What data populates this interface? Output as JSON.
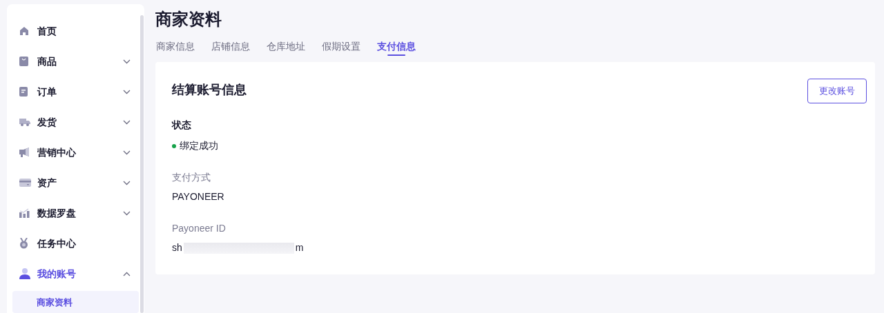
{
  "sidebar": {
    "items": [
      {
        "label": "首页",
        "selected": false
      },
      {
        "label": "商品",
        "selected": false,
        "expanded": false
      },
      {
        "label": "订单",
        "selected": false,
        "expanded": false
      },
      {
        "label": "发货",
        "selected": false,
        "expanded": false
      },
      {
        "label": "营销中心",
        "selected": false,
        "expanded": false
      },
      {
        "label": "资产",
        "selected": false,
        "expanded": false
      },
      {
        "label": "数据罗盘",
        "selected": false,
        "expanded": false
      },
      {
        "label": "任务中心",
        "selected": false
      },
      {
        "label": "我的账号",
        "selected": true,
        "expanded": true,
        "children": [
          {
            "label": "商家资料",
            "selected": true
          }
        ]
      }
    ]
  },
  "page": {
    "title": "商家资料"
  },
  "tabs": [
    {
      "label": "商家信息",
      "selected": false
    },
    {
      "label": "店铺信息",
      "selected": false
    },
    {
      "label": "仓库地址",
      "selected": false
    },
    {
      "label": "假期设置",
      "selected": false
    },
    {
      "label": "支付信息",
      "selected": true
    }
  ],
  "card": {
    "title": "结算账号信息",
    "button": "更改账号",
    "status": {
      "label": "状态",
      "value": "绑定成功",
      "color": "#16a34a"
    },
    "fields": [
      {
        "label": "支付方式",
        "value": "PAYONEER"
      },
      {
        "label": "Payoneer ID",
        "value_start": "sh",
        "value_end": "m",
        "redacted": true
      }
    ]
  }
}
